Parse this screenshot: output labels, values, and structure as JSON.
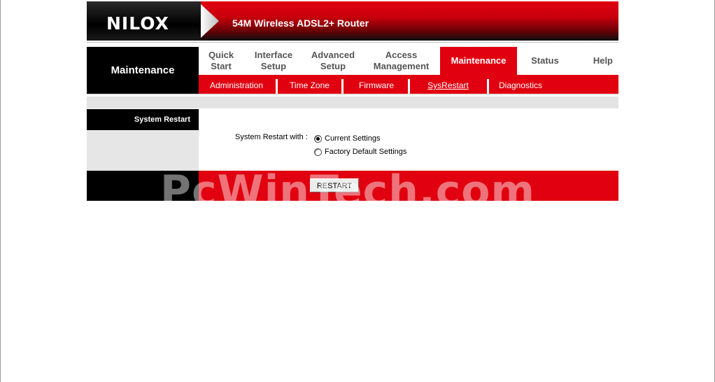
{
  "header": {
    "logo_text": "NILOX",
    "product_title": "54M Wireless ADSL2+ Router"
  },
  "section_title": "Maintenance",
  "nav": {
    "tabs": [
      {
        "label": "Quick\nStart"
      },
      {
        "label": "Interface\nSetup"
      },
      {
        "label": "Advanced\nSetup"
      },
      {
        "label": "Access\nManagement"
      },
      {
        "label": "Maintenance",
        "active": true
      },
      {
        "label": "Status"
      },
      {
        "label": "Help"
      }
    ],
    "subtabs": [
      {
        "label": "Administration"
      },
      {
        "label": "Time Zone"
      },
      {
        "label": "Firmware"
      },
      {
        "label": "SysRestart",
        "current": true
      },
      {
        "label": "Diagnostics"
      }
    ]
  },
  "sidebar": {
    "label": "System Restart"
  },
  "form": {
    "restart_with_label": "System Restart with :",
    "options": [
      {
        "label": "Current Settings",
        "checked": true
      },
      {
        "label": "Factory Default Settings",
        "checked": false
      }
    ],
    "restart_button": "RESTART"
  },
  "watermark": "PcWinTech.com",
  "colors": {
    "brand_red": "#e0000f",
    "black": "#000000",
    "light_grey": "#e3e3e3"
  }
}
